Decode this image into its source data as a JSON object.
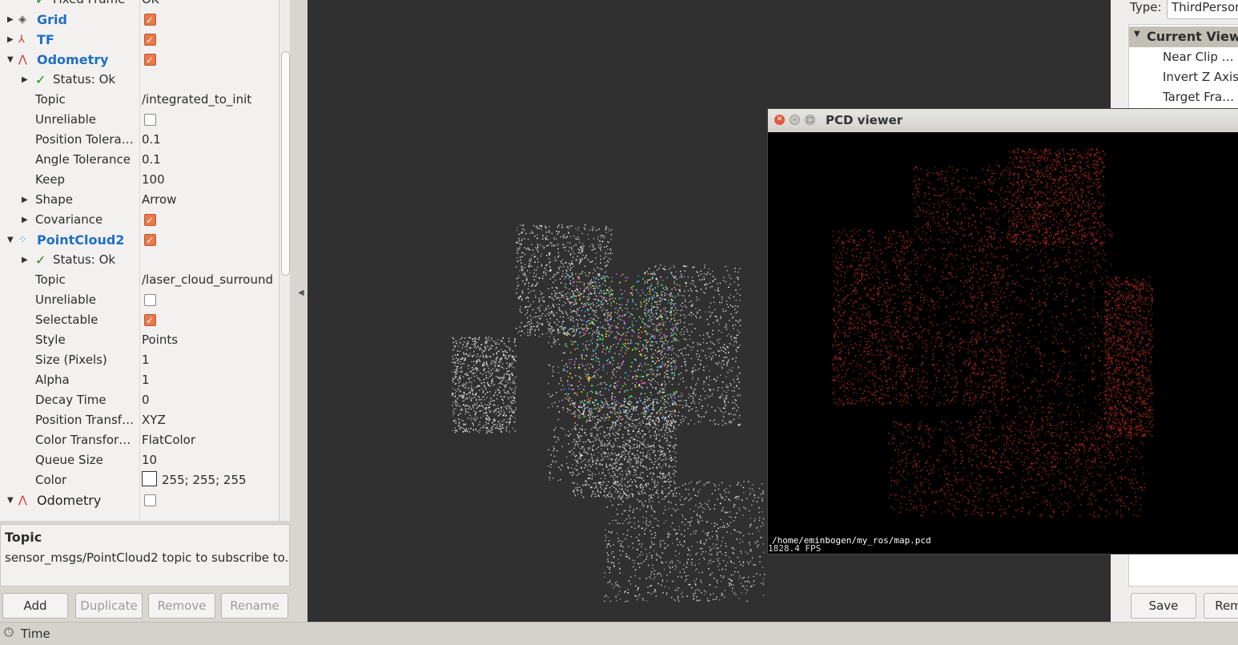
{
  "left_panel": {
    "rows": [
      {
        "indent": 1,
        "arrow": "",
        "icon": "✓",
        "name": "Fixed Frame",
        "value": "OK",
        "kind": "status"
      },
      {
        "indent": 0,
        "arrow": "▶",
        "icon": "◈",
        "name": "Grid",
        "check": true,
        "kind": "group"
      },
      {
        "indent": 0,
        "arrow": "▶",
        "icon": "⅄",
        "name": "TF",
        "check": true,
        "kind": "group"
      },
      {
        "indent": 0,
        "arrow": "▼",
        "icon": "⋀",
        "name": "Odometry",
        "check": true,
        "kind": "group"
      },
      {
        "indent": 1,
        "arrow": "▶",
        "icon": "✓",
        "name": "Status: Ok",
        "kind": "status"
      },
      {
        "indent": 1,
        "arrow": "",
        "name": "Topic",
        "value": "/integrated_to_init"
      },
      {
        "indent": 1,
        "arrow": "",
        "name": "Unreliable",
        "check": false
      },
      {
        "indent": 1,
        "arrow": "",
        "name": "Position Tolera…",
        "value": "0.1"
      },
      {
        "indent": 1,
        "arrow": "",
        "name": "Angle Tolerance",
        "value": "0.1"
      },
      {
        "indent": 1,
        "arrow": "",
        "name": "Keep",
        "value": "100"
      },
      {
        "indent": 1,
        "arrow": "▶",
        "name": "Shape",
        "value": "Arrow"
      },
      {
        "indent": 1,
        "arrow": "▶",
        "name": "Covariance",
        "check": true
      },
      {
        "indent": 0,
        "arrow": "▼",
        "icon": "⁘",
        "name": "PointCloud2",
        "check": true,
        "kind": "group"
      },
      {
        "indent": 1,
        "arrow": "▶",
        "icon": "✓",
        "name": "Status: Ok",
        "kind": "status"
      },
      {
        "indent": 1,
        "arrow": "",
        "name": "Topic",
        "value": "/laser_cloud_surround"
      },
      {
        "indent": 1,
        "arrow": "",
        "name": "Unreliable",
        "check": false
      },
      {
        "indent": 1,
        "arrow": "",
        "name": "Selectable",
        "check": true
      },
      {
        "indent": 1,
        "arrow": "",
        "name": "Style",
        "value": "Points"
      },
      {
        "indent": 1,
        "arrow": "",
        "name": "Size (Pixels)",
        "value": "1"
      },
      {
        "indent": 1,
        "arrow": "",
        "name": "Alpha",
        "value": "1"
      },
      {
        "indent": 1,
        "arrow": "",
        "name": "Decay Time",
        "value": "0"
      },
      {
        "indent": 1,
        "arrow": "",
        "name": "Position Transf…",
        "value": "XYZ"
      },
      {
        "indent": 1,
        "arrow": "",
        "name": "Color Transfor…",
        "value": "FlatColor"
      },
      {
        "indent": 1,
        "arrow": "",
        "name": "Queue Size",
        "value": "10"
      },
      {
        "indent": 1,
        "arrow": "",
        "name": "Color",
        "value": "255; 255; 255",
        "swatch": "#ffffff"
      },
      {
        "indent": 0,
        "arrow": "▼",
        "icon": "⋀",
        "name": "Odometry",
        "check": false,
        "kind": "group-plain"
      }
    ]
  },
  "description": {
    "title": "Topic",
    "text": "sensor_msgs/PointCloud2 topic to subscribe to."
  },
  "buttons": {
    "add": "Add",
    "duplicate": "Duplicate",
    "remove": "Remove",
    "rename": "Rename"
  },
  "views_panel": {
    "type_label": "Type:",
    "type_value": "ThirdPerson",
    "current_view": "Current View",
    "props": [
      "Near Clip …",
      "Invert Z Axis",
      "Target Fra…"
    ],
    "save": "Save",
    "remove": "Rem"
  },
  "pcd_viewer": {
    "title": "PCD viewer",
    "path": "/home/eminbogen/my_ros/map.pcd",
    "fps": "1828.4 FPS",
    "cloud_color": "#a52a1a"
  },
  "status_bar": {
    "label": "Time"
  },
  "colors": {
    "accent": "#1f6fc4",
    "checkbox": "#e9784a",
    "viewport_bg": "#303030"
  }
}
